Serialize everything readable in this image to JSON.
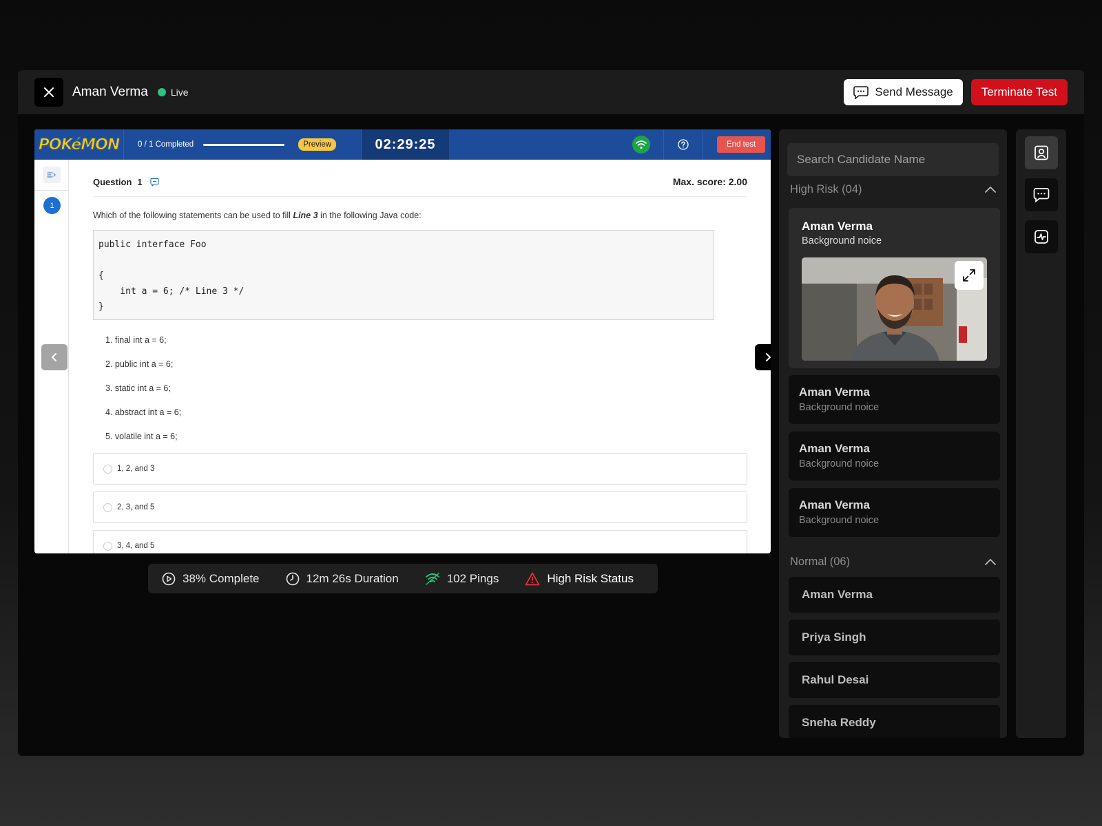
{
  "header": {
    "candidate_name": "Aman Verma",
    "status_label": "Live",
    "send_message_label": "Send Message",
    "terminate_label": "Terminate Test"
  },
  "exam": {
    "brand": "POKéMON",
    "completed_label": "0 / 1 Completed",
    "preview_label": "Preview",
    "timer": "02:29:25",
    "end_test_label": "End test",
    "question_label": "Question",
    "question_number": "1",
    "max_score": "Max. score: 2.00",
    "question_text_before": "Which of the following statements can be used to fill ",
    "question_text_emph": "Line 3",
    "question_text_after": " in the following Java code:",
    "code": "public interface Foo\n\n{\n    int a = 6; /* Line 3 */\n}",
    "options": [
      "1. final int a = 6;",
      "2. public int a = 6;",
      "3. static int a = 6;",
      "4. abstract int a = 6;",
      "5. volatile int a = 6;"
    ],
    "answers": [
      "1, 2, and 3",
      "2, 3, and 5",
      "3, 4, and 5"
    ]
  },
  "stats": {
    "complete": "38% Complete",
    "duration_value": "12m 26s",
    "duration_label": " Duration",
    "pings_value": "102",
    "pings_label": " Pings",
    "risk": "High Risk Status"
  },
  "candidates": {
    "search_placeholder": "Search Candidate Name",
    "high_risk_label": "High Risk (04)",
    "normal_label": "Normal (06)",
    "high_risk": [
      {
        "name": "Aman Verma",
        "reason": "Background noice"
      },
      {
        "name": "Aman Verma",
        "reason": "Background noice"
      },
      {
        "name": "Aman Verma",
        "reason": "Background noice"
      },
      {
        "name": "Aman Verma",
        "reason": "Background noice"
      }
    ],
    "normal": [
      "Aman Verma",
      "Priya Singh",
      "Rahul Desai",
      "Sneha Reddy"
    ]
  },
  "colors": {
    "terminate": "#d0101b",
    "live": "#2ec27e",
    "exam_header": "#1d4d9a",
    "risk_icon": "#e5343a",
    "ping_icon": "#2ec27e"
  }
}
